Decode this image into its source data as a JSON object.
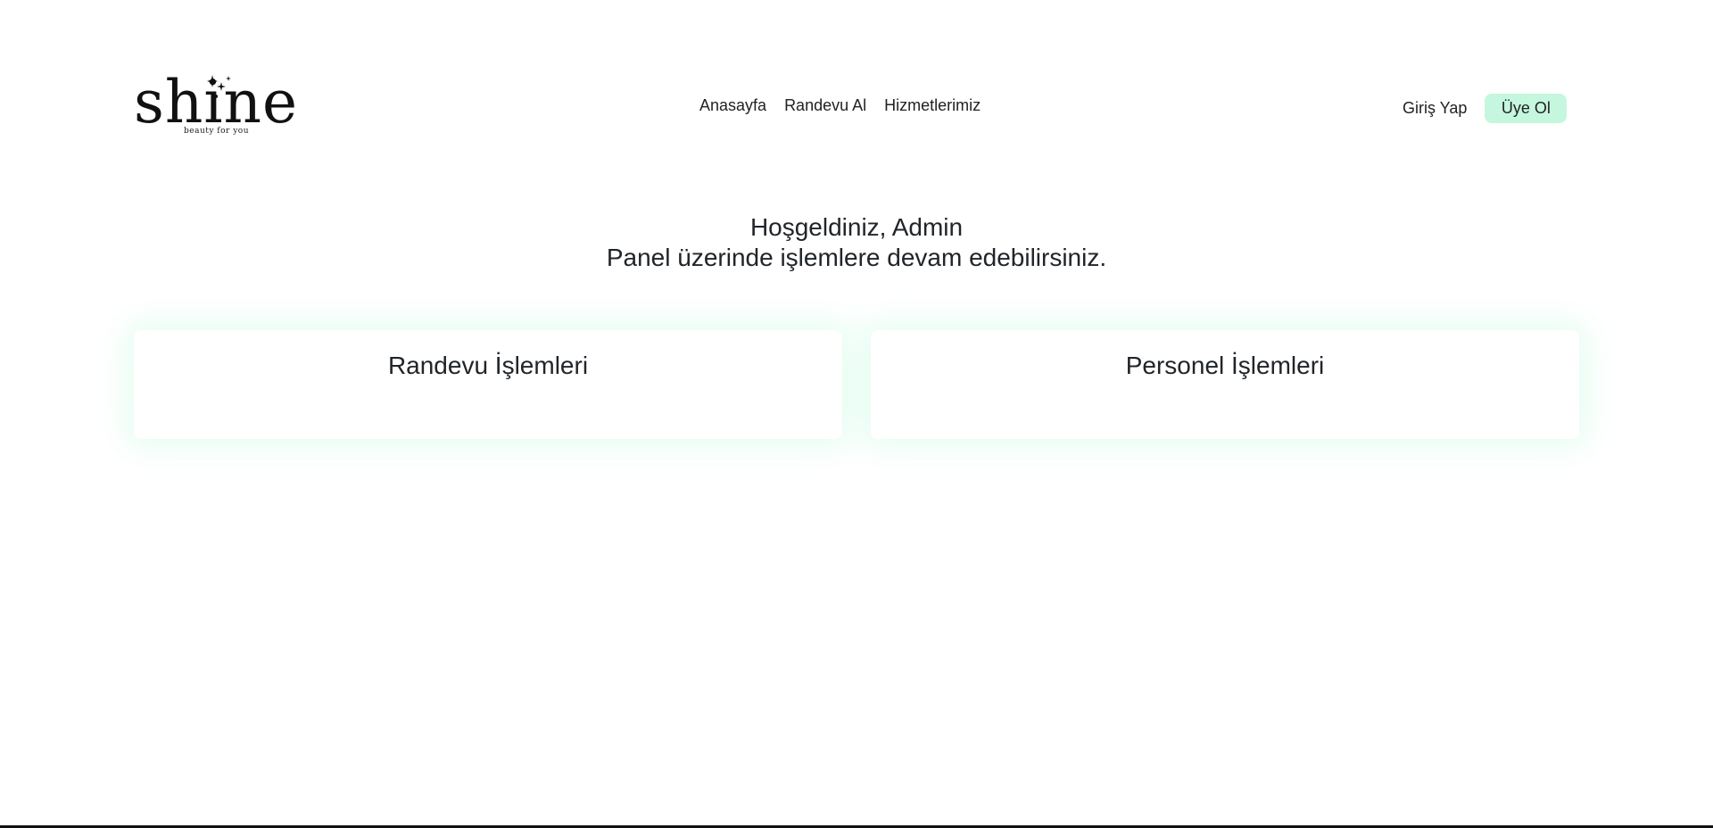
{
  "brand": {
    "logo_text": "shine",
    "tagline": "beauty for you"
  },
  "nav": {
    "items": [
      {
        "label": "Anasayfa"
      },
      {
        "label": "Randevu Al"
      },
      {
        "label": "Hizmetlerimiz"
      }
    ]
  },
  "auth": {
    "login_label": "Giriş Yap",
    "signup_label": "Üye Ol"
  },
  "welcome": {
    "line1": "Hoşgeldiniz, Admin",
    "line2": "Panel üzerinde işlemlere devam edebilirsiniz."
  },
  "cards": [
    {
      "title": "Randevu İşlemleri"
    },
    {
      "title": "Personel İşlemleri"
    }
  ],
  "colors": {
    "accent": "#c5f7de",
    "card_glow": "#78f5b4",
    "text": "#212529"
  }
}
